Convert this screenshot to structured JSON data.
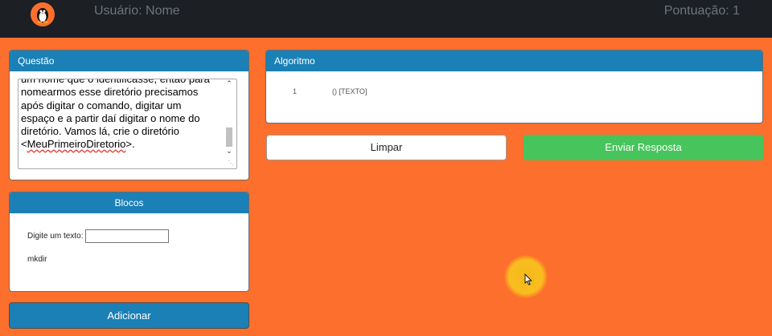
{
  "header": {
    "user_label": "Usuário: Nome",
    "score_label": "Pontuação: 1",
    "logo_icon": "tux-penguin-icon"
  },
  "questao": {
    "title": "Questão",
    "text_before": "um nome que o identificasse, então para\nnomearmos esse diretório precisamos\napós digitar o comando, digitar um\nespaço e a partir daí digitar o nome do\ndiretório. Vamos lá, crie o diretório\n<",
    "text_spell": "MeuPrimeiroDiretorio",
    "text_after": ">."
  },
  "blocos": {
    "title": "Blocos",
    "input_label": "Digite um texto:",
    "input_value": "",
    "item": "mkdir"
  },
  "add_button": "Adicionar",
  "algoritmo": {
    "title": "Algoritmo",
    "line_number": "1",
    "line_content": "() [TEXTO]"
  },
  "buttons": {
    "clear": "Limpar",
    "submit": "Enviar Resposta"
  },
  "colors": {
    "background": "#fd6f2c",
    "topbar": "#1c1f23",
    "panel_header": "#1a80b6",
    "submit_button": "#47c45c"
  }
}
